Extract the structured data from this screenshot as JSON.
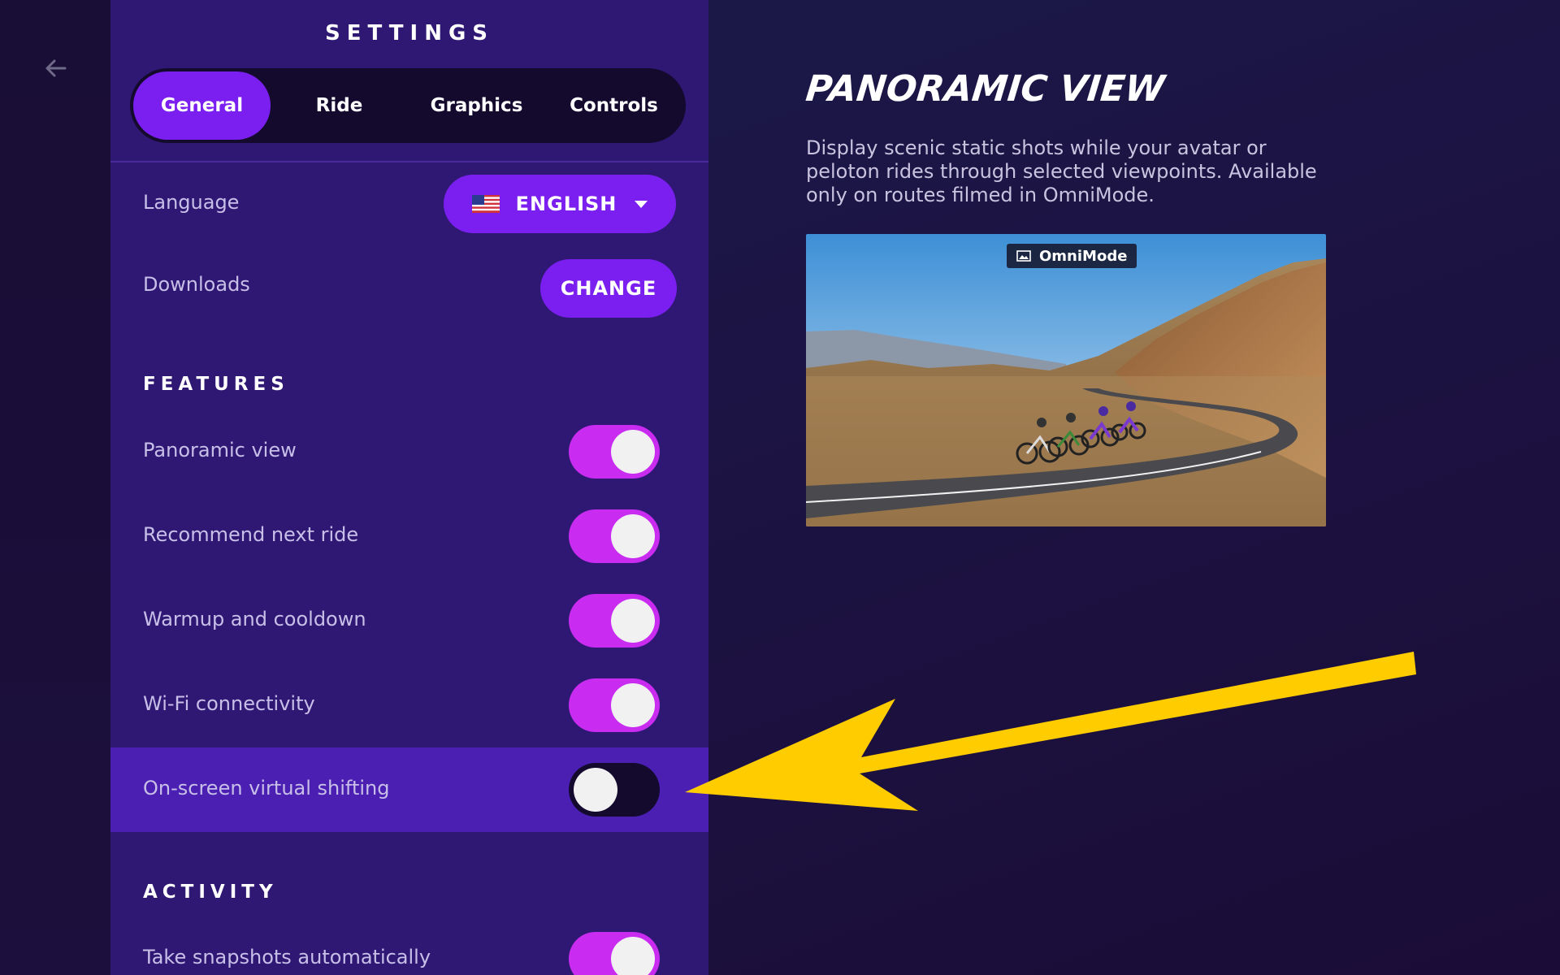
{
  "settings": {
    "title": "SETTINGS",
    "tabs": [
      {
        "label": "General",
        "active": true
      },
      {
        "label": "Ride",
        "active": false
      },
      {
        "label": "Graphics",
        "active": false
      },
      {
        "label": "Controls",
        "active": false
      }
    ],
    "language": {
      "label": "Language",
      "value": "ENGLISH",
      "flag_icon": "us-flag-icon"
    },
    "downloads": {
      "label": "Downloads",
      "button": "CHANGE"
    },
    "features": {
      "heading": "FEATURES",
      "items": [
        {
          "label": "Panoramic view",
          "enabled": true
        },
        {
          "label": "Recommend next ride",
          "enabled": true
        },
        {
          "label": "Warmup and cooldown",
          "enabled": true
        },
        {
          "label": "Wi-Fi connectivity",
          "enabled": true
        },
        {
          "label": "On-screen virtual shifting",
          "enabled": false
        }
      ]
    },
    "activity": {
      "heading": "ACTIVITY",
      "items": [
        {
          "label": "Take snapshots automatically",
          "enabled": true
        }
      ]
    }
  },
  "detail": {
    "title": "PANORAMIC VIEW",
    "description": "Display scenic static shots while your avatar or peloton rides through selected viewpoints. Available only on routes filmed in OmniMode.",
    "image_badge": "OmniMode"
  },
  "colors": {
    "accent": "#7a1ff0",
    "toggle_on": "#c92cf0",
    "arrow": "#ffcc00",
    "panel": "#2f1874",
    "highlight": "#4a1fb2"
  }
}
